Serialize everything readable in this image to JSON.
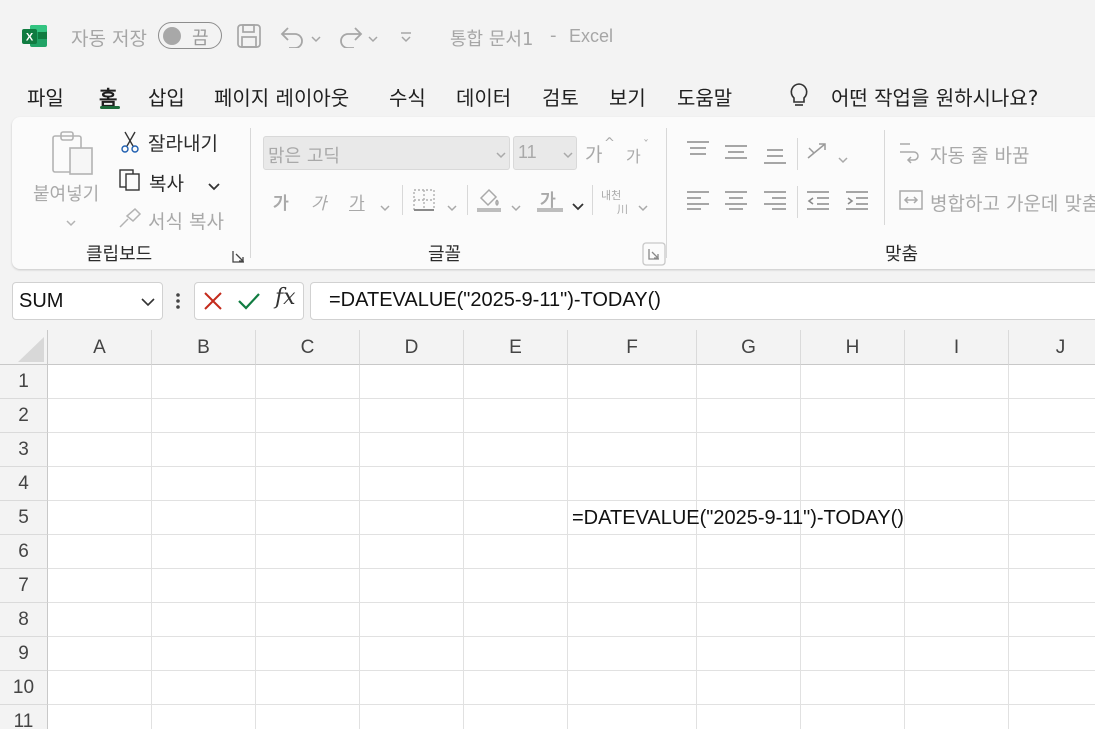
{
  "titlebar": {
    "autosave_label": "자동 저장",
    "autosave_state": "끔",
    "document_title": "통합 문서1",
    "separator": "-",
    "app_name": "Excel"
  },
  "menu": {
    "tabs": [
      "파일",
      "홈",
      "삽입",
      "페이지 레이아웃",
      "수식",
      "데이터",
      "검토",
      "보기",
      "도움말"
    ],
    "active_tab": "홈",
    "search_placeholder": "어떤 작업을 원하시나요?"
  },
  "ribbon": {
    "clipboard": {
      "paste": "붙여넣기",
      "cut": "잘라내기",
      "copy": "복사",
      "format_painter": "서식 복사",
      "group_label": "클립보드"
    },
    "font": {
      "font_name": "맑은 고딕",
      "font_size": "11",
      "increase_font": "가",
      "decrease_font": "가",
      "bold": "가",
      "italic": "가",
      "underline": "가",
      "font_color": "가",
      "phonetic_top": "내천",
      "phonetic_bottom": "川",
      "group_label": "글꼴"
    },
    "alignment": {
      "wrap_text": "자동 줄 바꿈",
      "merge_center": "병합하고 가운데 맞춤",
      "group_label": "맞춤"
    }
  },
  "formula_bar": {
    "name_box": "SUM",
    "fx": "fx",
    "formula": "=DATEVALUE(\"2025-9-11\")-TODAY()"
  },
  "sheet": {
    "columns": [
      "A",
      "B",
      "C",
      "D",
      "E",
      "F",
      "G",
      "H",
      "I",
      "J"
    ],
    "rows": [
      "1",
      "2",
      "3",
      "4",
      "5",
      "6",
      "7",
      "8",
      "9",
      "10",
      "11"
    ],
    "active_cell_ref": "F5",
    "active_cell_text": "=DATEVALUE(\"2025-9-11\")-TODAY()"
  },
  "colors": {
    "excel_green": "#1d6b3b",
    "cancel_red": "#c42b1c",
    "enter_green": "#107c41"
  }
}
